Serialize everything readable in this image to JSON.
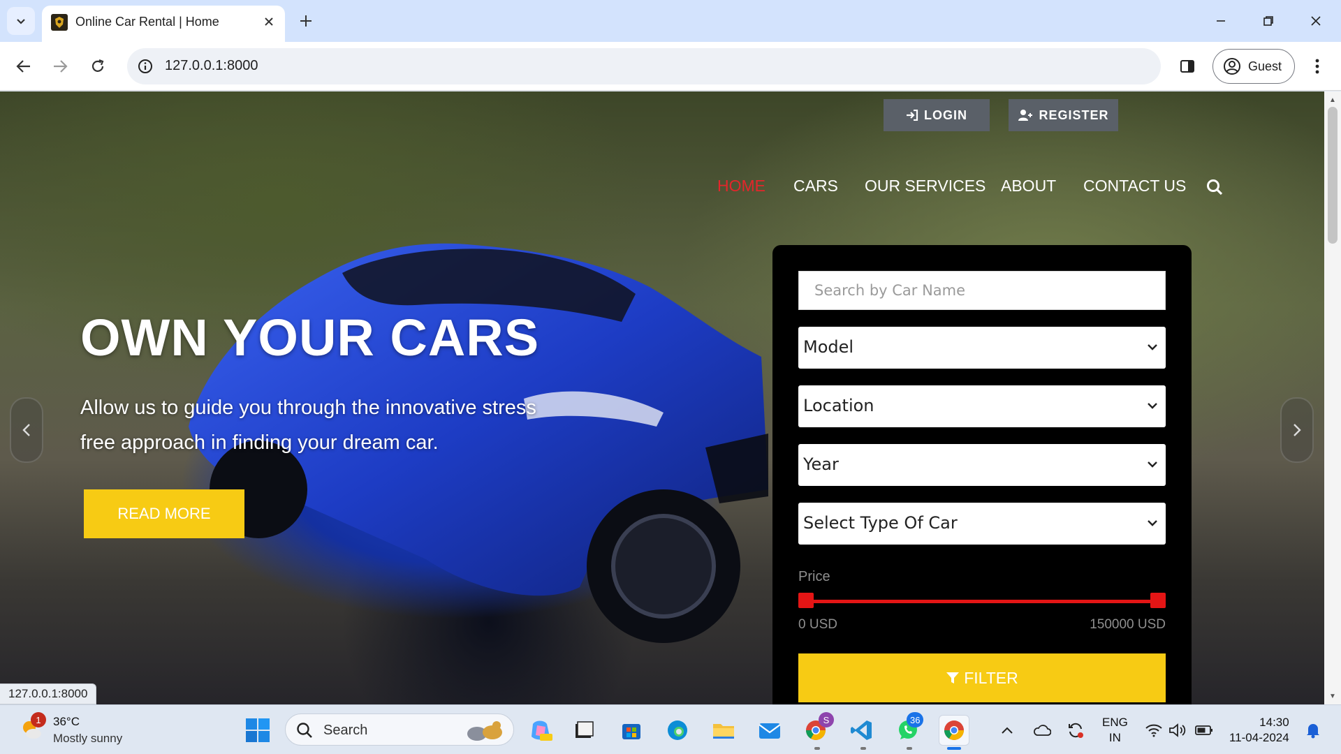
{
  "browser": {
    "tab_title": "Online Car Rental | Home",
    "url": "127.0.0.1:8000",
    "profile_label": "Guest",
    "status_url": "127.0.0.1:8000"
  },
  "header": {
    "login_label": "LOGIN",
    "register_label": "REGISTER",
    "nav": [
      {
        "label": "HOME",
        "active": true
      },
      {
        "label": "CARS",
        "active": false
      },
      {
        "label": "OUR SERVICES",
        "active": false
      },
      {
        "label": "ABOUT",
        "active": false
      },
      {
        "label": "CONTACT US",
        "active": false
      }
    ]
  },
  "hero": {
    "title": "OWN YOUR CARS",
    "text": "Allow us to guide you through the innovative stress free approach in finding your dream car.",
    "button_label": "READ MORE"
  },
  "filter": {
    "search_placeholder": "Search by Car Name",
    "selects": {
      "model": "Model",
      "location": "Location",
      "year": "Year",
      "type": "Select Type Of Car"
    },
    "price_label": "Price",
    "price_min": "0 USD",
    "price_max": "150000 USD",
    "button_label": "FILTER"
  },
  "taskbar": {
    "weather_badge": "1",
    "weather_temp": "36°C",
    "weather_desc": "Mostly sunny",
    "search_label": "Search",
    "whatsapp_badge": "36",
    "chrome_profile_badge": "S",
    "lang_line1": "ENG",
    "lang_line2": "IN",
    "time": "14:30",
    "date": "11-04-2024"
  },
  "colors": {
    "accent_yellow": "#f7cb14",
    "active_nav_red": "#e3262b",
    "slider_red": "#e41515"
  }
}
